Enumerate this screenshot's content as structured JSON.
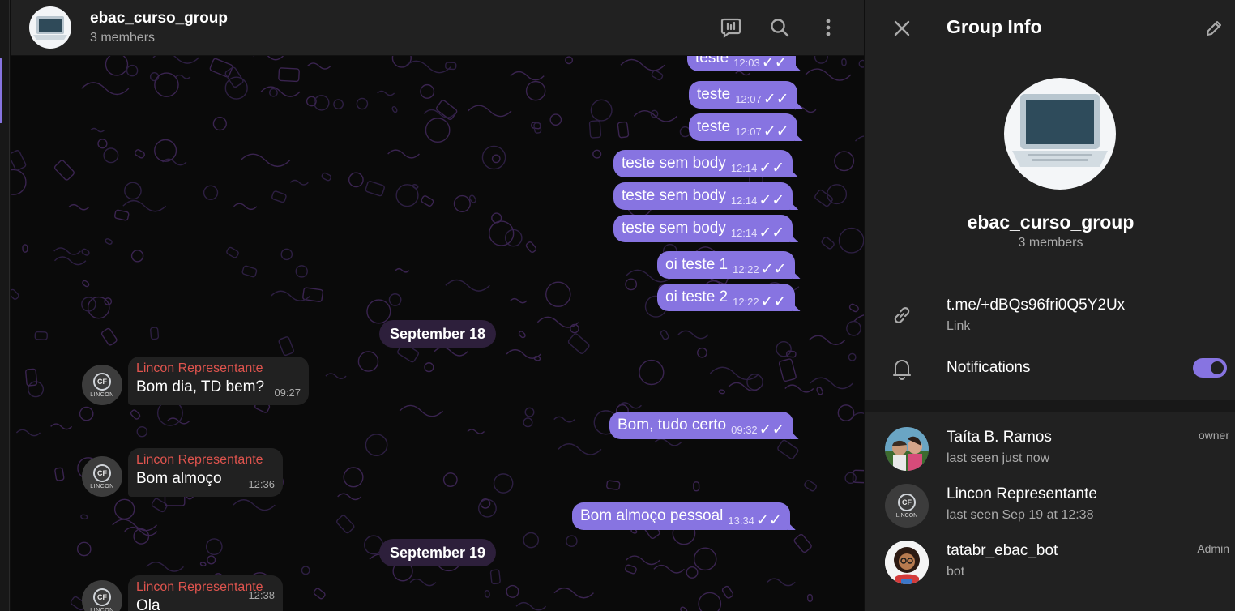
{
  "chat": {
    "title": "ebac_curso_group",
    "subtitle": "3 members",
    "outgoing": [
      {
        "text": "teste",
        "time": "12:03"
      },
      {
        "text": "teste",
        "time": "12:07"
      },
      {
        "text": "teste",
        "time": "12:07"
      },
      {
        "text": "teste sem body",
        "time": "12:14"
      },
      {
        "text": "teste sem body",
        "time": "12:14"
      },
      {
        "text": "teste sem body",
        "time": "12:14"
      },
      {
        "text": "oi teste 1",
        "time": "12:22"
      },
      {
        "text": "oi teste 2",
        "time": "12:22"
      },
      {
        "text": "Bom, tudo certo",
        "time": "09:32"
      },
      {
        "text": "Bom almoço pessoal",
        "time": "13:34"
      }
    ],
    "incoming": [
      {
        "sender": "Lincon Representante",
        "text": "Bom dia, TD bem?",
        "time": "09:27"
      },
      {
        "sender": "Lincon Representante",
        "text": "Bom almoço",
        "time": "12:36"
      },
      {
        "sender": "Lincon Representante",
        "text": "Ola",
        "time": "12:38"
      }
    ],
    "dates": [
      "September 18",
      "September 19"
    ],
    "avatar_label": "LINCON"
  },
  "info": {
    "header_title": "Group Info",
    "name": "ebac_curso_group",
    "members_count": "3 members",
    "link_value": "t.me/+dBQs96fri0Q5Y2Ux",
    "link_label": "Link",
    "notifications_label": "Notifications",
    "notifications_on": true,
    "members": [
      {
        "name": "Taíta B. Ramos",
        "status": "last seen just now",
        "role": "owner"
      },
      {
        "name": "Lincon Representante",
        "status": "last seen Sep 19 at 12:38",
        "role": ""
      },
      {
        "name": "tatabr_ebac_bot",
        "status": "bot",
        "role": "Admin"
      }
    ]
  },
  "colors": {
    "accent": "#8774e1",
    "sender_name": "#e0544e",
    "panel": "#212121"
  }
}
